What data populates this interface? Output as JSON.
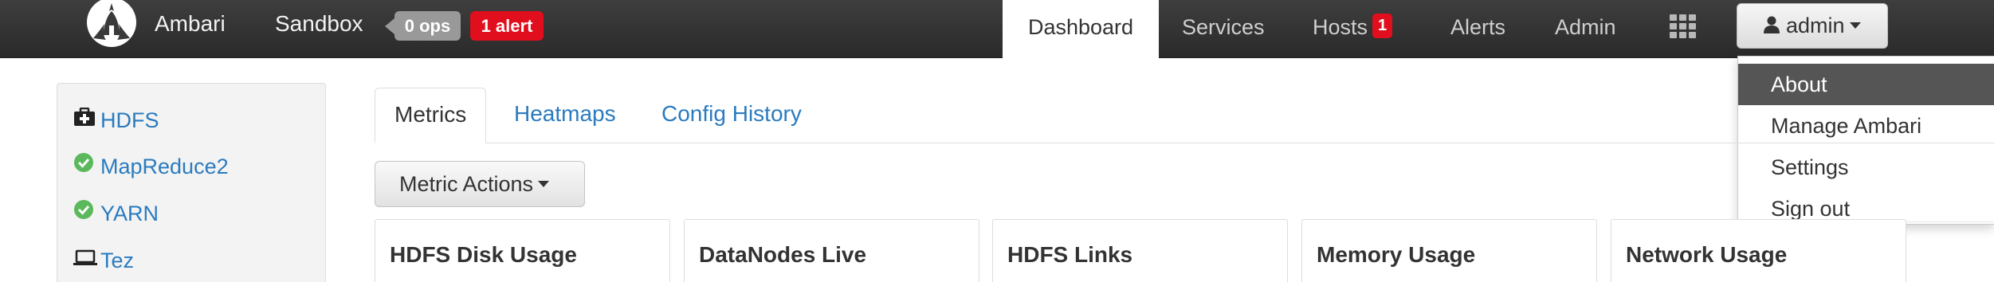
{
  "navbar": {
    "brand": "Ambari",
    "cluster_name": "Sandbox",
    "ops_badge": "0 ops",
    "alert_badge": "1 alert",
    "nav_items": {
      "dashboard": "Dashboard",
      "services": "Services",
      "hosts": "Hosts",
      "hosts_count": "1",
      "alerts": "Alerts",
      "admin": "Admin"
    },
    "views_icon": "grid-icon",
    "user_menu": "admin"
  },
  "user_dropdown": {
    "items": [
      "About",
      "Manage Ambari",
      "Settings",
      "Sign out"
    ],
    "highlighted": "About"
  },
  "sidebar": {
    "services": [
      {
        "name": "HDFS",
        "icon": "medkit-icon"
      },
      {
        "name": "MapReduce2",
        "icon": "check-circle-icon"
      },
      {
        "name": "YARN",
        "icon": "check-circle-icon"
      },
      {
        "name": "Tez",
        "icon": "laptop-icon"
      }
    ]
  },
  "tabs": {
    "metrics": "Metrics",
    "heatmaps": "Heatmaps",
    "config_history": "Config History",
    "active": "Metrics"
  },
  "metric_actions": "Metric Actions",
  "widgets": [
    "HDFS Disk Usage",
    "DataNodes Live",
    "HDFS Links",
    "Memory Usage",
    "Network Usage"
  ],
  "colors": {
    "navbar_bg": "#333333",
    "link": "#2a7bbf",
    "alert_red": "#e10e1d",
    "ops_gray": "#999999",
    "ok_green": "#5cb85c",
    "dropdown_highlight": "#555555"
  }
}
